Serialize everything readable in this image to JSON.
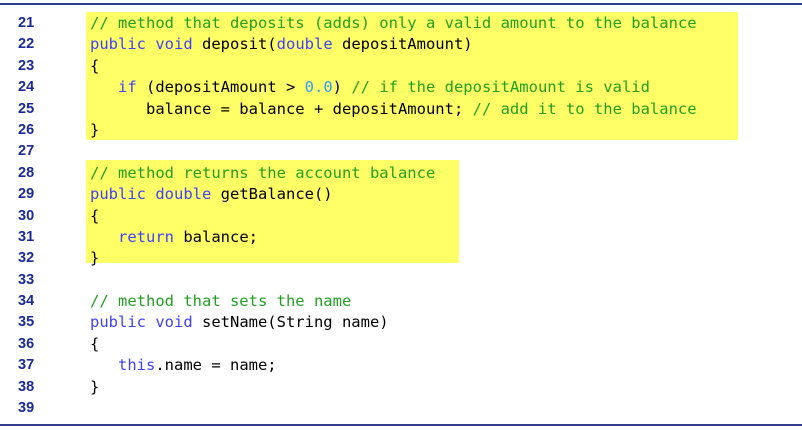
{
  "lines": [
    {
      "num": "21",
      "tokens": [
        {
          "t": "cm",
          "v": "// method that deposits (adds) only a valid amount to the balance"
        }
      ]
    },
    {
      "num": "22",
      "tokens": [
        {
          "t": "kw",
          "v": "public void"
        },
        {
          "t": "tx",
          "v": " deposit("
        },
        {
          "t": "kw",
          "v": "double"
        },
        {
          "t": "tx",
          "v": " depositAmount)"
        }
      ]
    },
    {
      "num": "23",
      "tokens": [
        {
          "t": "tx",
          "v": "{"
        }
      ]
    },
    {
      "num": "24",
      "tokens": [
        {
          "t": "tx",
          "v": "   "
        },
        {
          "t": "kw",
          "v": "if"
        },
        {
          "t": "tx",
          "v": " (depositAmount > "
        },
        {
          "t": "num",
          "v": "0.0"
        },
        {
          "t": "tx",
          "v": ") "
        },
        {
          "t": "cm",
          "v": "// if the depositAmount is valid"
        }
      ]
    },
    {
      "num": "25",
      "tokens": [
        {
          "t": "tx",
          "v": "      balance = balance + depositAmount; "
        },
        {
          "t": "cm",
          "v": "// add it to the balance"
        }
      ]
    },
    {
      "num": "26",
      "tokens": [
        {
          "t": "tx",
          "v": "}"
        }
      ]
    },
    {
      "num": "27",
      "tokens": []
    },
    {
      "num": "28",
      "tokens": [
        {
          "t": "cm",
          "v": "// method returns the account balance"
        }
      ]
    },
    {
      "num": "29",
      "tokens": [
        {
          "t": "kw",
          "v": "public double"
        },
        {
          "t": "tx",
          "v": " getBalance()"
        }
      ]
    },
    {
      "num": "30",
      "tokens": [
        {
          "t": "tx",
          "v": "{"
        }
      ]
    },
    {
      "num": "31",
      "tokens": [
        {
          "t": "tx",
          "v": "   "
        },
        {
          "t": "kw",
          "v": "return"
        },
        {
          "t": "tx",
          "v": " balance;"
        }
      ]
    },
    {
      "num": "32",
      "tokens": [
        {
          "t": "tx",
          "v": "}"
        }
      ]
    },
    {
      "num": "33",
      "tokens": []
    },
    {
      "num": "34",
      "tokens": [
        {
          "t": "cm",
          "v": "// method that sets the name"
        }
      ]
    },
    {
      "num": "35",
      "tokens": [
        {
          "t": "kw",
          "v": "public void"
        },
        {
          "t": "tx",
          "v": " setName(String name)"
        }
      ]
    },
    {
      "num": "36",
      "tokens": [
        {
          "t": "tx",
          "v": "{"
        }
      ]
    },
    {
      "num": "37",
      "tokens": [
        {
          "t": "tx",
          "v": "   "
        },
        {
          "t": "kw",
          "v": "this"
        },
        {
          "t": "tx",
          "v": ".name = name;"
        }
      ]
    },
    {
      "num": "38",
      "tokens": [
        {
          "t": "tx",
          "v": "}"
        }
      ]
    },
    {
      "num": "39",
      "tokens": []
    }
  ],
  "colors": {
    "keyword": "#4040ff",
    "comment": "#22a022",
    "number": "#3399ff",
    "line_number": "#1a2a9a",
    "highlight": "#ffff66",
    "rule": "#2f3f8f"
  }
}
